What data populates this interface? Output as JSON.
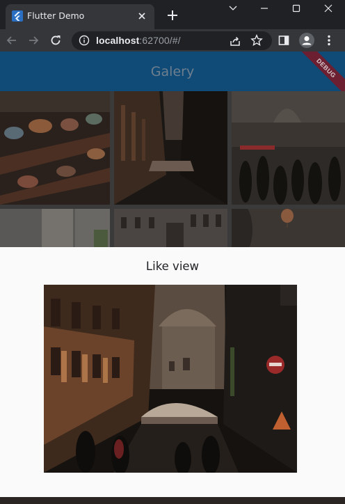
{
  "browser": {
    "tab_title": "Flutter Demo",
    "url_host": "localhost",
    "url_rest": ":62700/#/",
    "accent": "#202124"
  },
  "icons": {
    "favicon": "flutter-logo-icon",
    "tab_close": "close-icon",
    "new_tab": "plus-icon",
    "back": "arrow-left-icon",
    "forward": "arrow-right-icon",
    "reload": "reload-icon",
    "site_info": "info-icon",
    "share": "share-icon",
    "bookmark": "star-icon",
    "side_panel": "side-panel-icon",
    "profile": "profile-icon",
    "menu": "kebab-menu-icon"
  },
  "app": {
    "title": "Galery",
    "debug_banner": "DEBUG",
    "appbar_color": "#104a77"
  },
  "gallery": {
    "images": [
      "teacups-shelf",
      "narrow-street",
      "crowded-square",
      "white-door",
      "building-facade",
      "hot-air-balloon"
    ]
  },
  "dialog": {
    "title": "Like view",
    "image": "narrow-street-large"
  }
}
